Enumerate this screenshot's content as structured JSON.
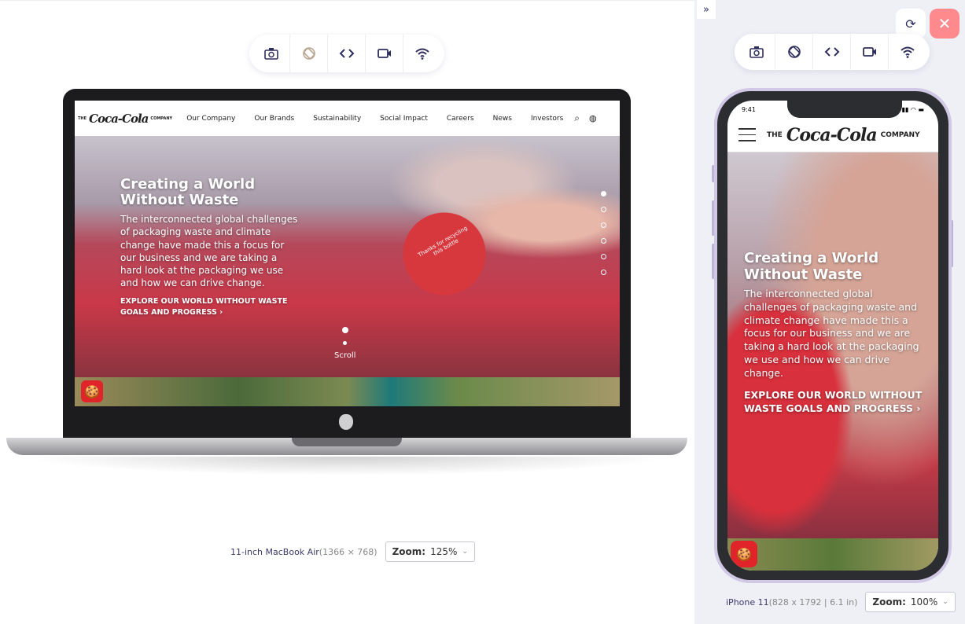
{
  "desktop": {
    "toolbar": [
      "camera-icon",
      "rotate-disabled-icon",
      "code-icon",
      "video-icon",
      "wifi-icon"
    ],
    "device_name": "11-inch MacBook Air",
    "device_res": "(1366 × 768)",
    "zoom_label": "Zoom:",
    "zoom_value": "125%"
  },
  "site": {
    "logo_the": "THE",
    "logo_brand": "Coca-Cola",
    "logo_company": "COMPANY",
    "nav": [
      "Our Company",
      "Our Brands",
      "Sustainability",
      "Social Impact",
      "Careers",
      "News",
      "Investors"
    ],
    "hero_title": "Creating a World Without Waste",
    "hero_body": "The interconnected global challenges of packaging waste and climate change have made this a focus for our business and we are taking a hard look at the packaging we use and how we can drive change.",
    "hero_cta": "EXPLORE OUR WORLD WITHOUT WASTE GOALS AND PROGRESS",
    "cap_text": "Thanks for recycling this bottle",
    "scroll_label": "Scroll",
    "slide_active": 1,
    "slide_count": 6
  },
  "mobile": {
    "toolbar": [
      "camera-icon",
      "rotate-icon",
      "code-icon",
      "video-icon",
      "wifi-icon"
    ],
    "status_time": "9:41",
    "device_name": "iPhone 11",
    "device_res": "(828 x 1792 | 6.1 in)",
    "zoom_label": "Zoom:",
    "zoom_value": "100%"
  },
  "colors": {
    "close_button": "#ff8a8e",
    "brand_red": "#e0242a",
    "panel_bg": "#eff0f6",
    "icon": "#2e2e5e"
  }
}
